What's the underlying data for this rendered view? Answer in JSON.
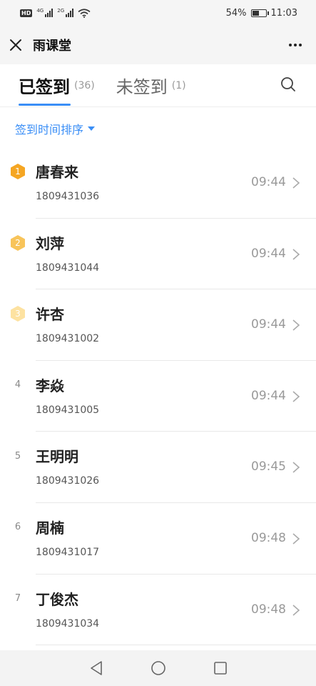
{
  "status_bar": {
    "hd": "HD",
    "signal1": "4G",
    "signal2": "2G",
    "battery": "54%",
    "battery_level": 0.54,
    "time": "11:03"
  },
  "title_bar": {
    "title": "雨课堂",
    "close_icon": "close-icon",
    "more_icon": "more-horizontal-icon"
  },
  "tabs": [
    {
      "label": "已签到",
      "count": "(36)",
      "active": true
    },
    {
      "label": "未签到",
      "count": "(1)",
      "active": false
    }
  ],
  "search_icon": "search-icon",
  "sort": {
    "label": "签到时间排序"
  },
  "colors": {
    "accent": "#3a8ef6",
    "rank1": "#f5a623",
    "rank2": "#f8c45a",
    "rank3": "#fde2a1"
  },
  "students": [
    {
      "rank": "1",
      "name": "唐春来",
      "id": "1809431036",
      "time": "09:44"
    },
    {
      "rank": "2",
      "name": "刘萍",
      "id": "1809431044",
      "time": "09:44"
    },
    {
      "rank": "3",
      "name": "许杏",
      "id": "1809431002",
      "time": "09:44"
    },
    {
      "rank": "4",
      "name": "李焱",
      "id": "1809431005",
      "time": "09:44"
    },
    {
      "rank": "5",
      "name": "王明明",
      "id": "1809431026",
      "time": "09:45"
    },
    {
      "rank": "6",
      "name": "周楠",
      "id": "1809431017",
      "time": "09:48"
    },
    {
      "rank": "7",
      "name": "丁俊杰",
      "id": "1809431034",
      "time": "09:48"
    }
  ]
}
